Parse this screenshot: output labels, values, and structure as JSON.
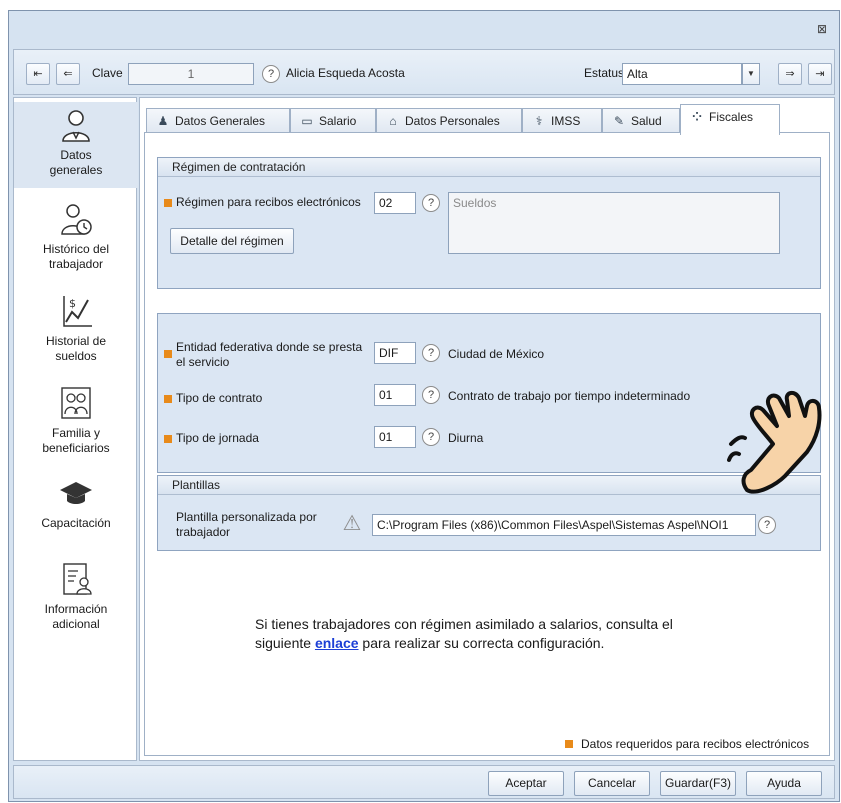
{
  "window": {
    "close_glyph": "⊠"
  },
  "toolbar": {
    "clave_label": "Clave",
    "clave_value": "1",
    "employee_name": "Alicia Esqueda Acosta",
    "estatus_label": "Estatus",
    "estatus_value": "Alta",
    "nav_first": "⇤",
    "nav_prev": "⇐",
    "nav_next": "⇒",
    "nav_last": "⇥",
    "help_glyph": "?",
    "dropdown_glyph": "▼"
  },
  "sidebar": {
    "items": [
      {
        "label": "Datos generales",
        "icon": "person-icon"
      },
      {
        "label": "Histórico del trabajador",
        "icon": "person-clock-icon"
      },
      {
        "label": "Historial de sueldos",
        "icon": "salary-chart-icon"
      },
      {
        "label": "Familia y beneficiarios",
        "icon": "family-icon"
      },
      {
        "label": "Capacitación",
        "icon": "graduation-cap-icon"
      },
      {
        "label": "Información adicional",
        "icon": "document-person-icon"
      }
    ]
  },
  "tabs": [
    {
      "label": "Datos Generales",
      "icon": "person-icon",
      "glyph": "♟"
    },
    {
      "label": "Salario",
      "icon": "money-icon",
      "glyph": "▭"
    },
    {
      "label": "Datos Personales",
      "icon": "house-icon",
      "glyph": "⌂"
    },
    {
      "label": "IMSS",
      "icon": "imss-icon",
      "glyph": "⚕"
    },
    {
      "label": "Salud",
      "icon": "syringe-icon",
      "glyph": "✎"
    },
    {
      "label": "Fiscales",
      "icon": "grid-dots-icon",
      "glyph": "⁘"
    }
  ],
  "regimen": {
    "group_title": "Régimen de contratación",
    "label": "Régimen para recibos electrónicos",
    "code": "02",
    "description": "Sueldos",
    "detail_button": "Detalle del régimen"
  },
  "servicio": {
    "entidad_label": "Entidad federativa donde se presta el servicio",
    "entidad_code": "DIF",
    "entidad_desc": "Ciudad de México",
    "contrato_label": "Tipo de contrato",
    "contrato_code": "01",
    "contrato_desc": "Contrato de trabajo por tiempo indeterminado",
    "jornada_label": "Tipo de jornada",
    "jornada_code": "01",
    "jornada_desc": "Diurna"
  },
  "plantillas": {
    "group_title": "Plantillas",
    "label": "Plantilla personalizada por trabajador",
    "path": "C:\\Program Files (x86)\\Common Files\\Aspel\\Sistemas Aspel\\NOI1",
    "warning_glyph": "⚠"
  },
  "notice": {
    "line1": "Si tienes trabajadores con régimen asimilado a salarios, consulta el",
    "line2_pre": "siguiente",
    "link": "enlace",
    "line2_post": "para realizar su correcta configuración."
  },
  "legend": {
    "text": "Datos requeridos para recibos electrónicos"
  },
  "footer": {
    "aceptar": "Aceptar",
    "cancelar": "Cancelar",
    "guardar": "Guardar(F3)",
    "ayuda": "Ayuda"
  },
  "colors": {
    "required_marker": "#e88a1a",
    "link": "#1c3fd6",
    "group_bg": "#dbe6f3",
    "window_bg": "#d6e3f1"
  }
}
